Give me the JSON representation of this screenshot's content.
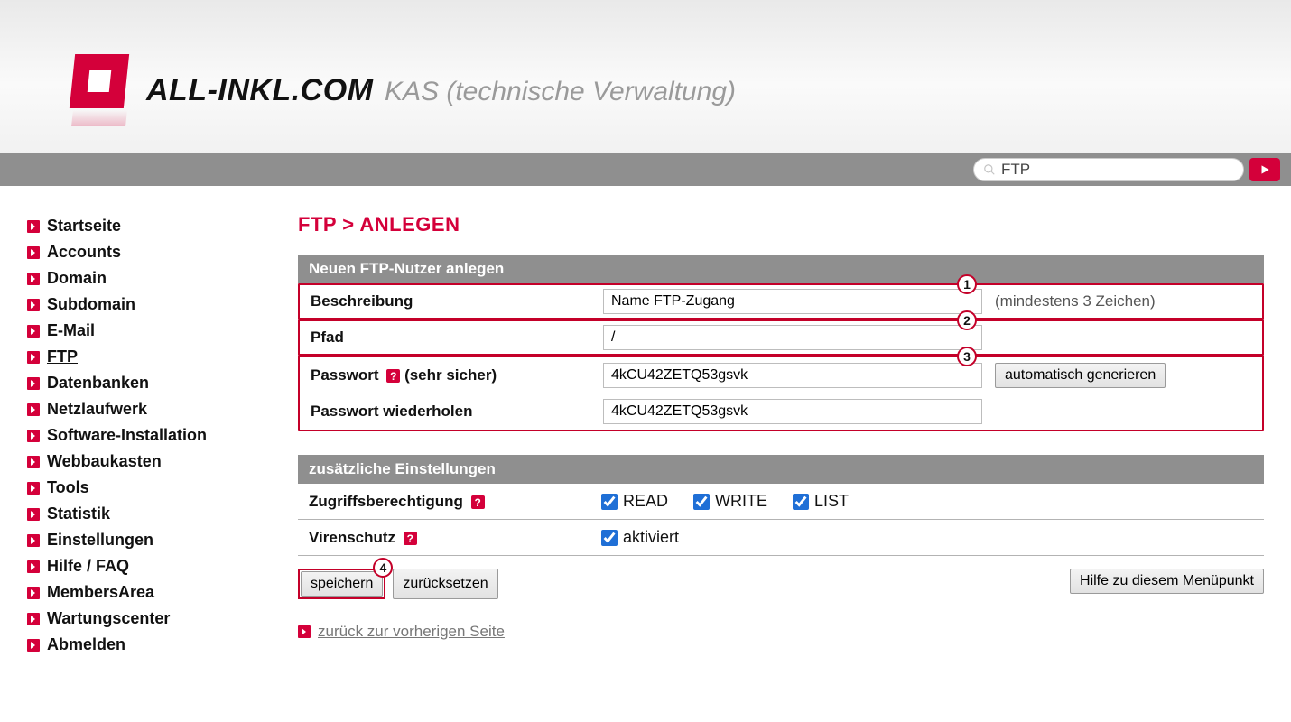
{
  "header": {
    "logo_text": "ALL-INKL.COM",
    "subtitle": "KAS (technische Verwaltung)"
  },
  "toolbar": {
    "search_value": "FTP"
  },
  "sidebar": {
    "items": [
      {
        "label": "Startseite",
        "active": false
      },
      {
        "label": "Accounts",
        "active": false
      },
      {
        "label": "Domain",
        "active": false
      },
      {
        "label": "Subdomain",
        "active": false
      },
      {
        "label": "E-Mail",
        "active": false
      },
      {
        "label": "FTP",
        "active": true
      },
      {
        "label": "Datenbanken",
        "active": false
      },
      {
        "label": "Netzlaufwerk",
        "active": false
      },
      {
        "label": "Software-Installation",
        "active": false
      },
      {
        "label": "Webbaukasten",
        "active": false
      },
      {
        "label": "Tools",
        "active": false
      },
      {
        "label": "Statistik",
        "active": false
      },
      {
        "label": "Einstellungen",
        "active": false
      },
      {
        "label": "Hilfe / FAQ",
        "active": false
      },
      {
        "label": "MembersArea",
        "active": false
      },
      {
        "label": "Wartungscenter",
        "active": false
      },
      {
        "label": "Abmelden",
        "active": false
      }
    ]
  },
  "main": {
    "title": "FTP > ANLEGEN",
    "panel1": {
      "heading": "Neuen FTP-Nutzer anlegen",
      "rows": {
        "beschreibung": {
          "label": "Beschreibung",
          "value": "Name FTP-Zugang",
          "hint": "(mindestens 3 Zeichen)",
          "step": "1"
        },
        "pfad": {
          "label": "Pfad",
          "value": "/",
          "step": "2"
        },
        "passwort": {
          "label": "Passwort",
          "strength": "(sehr sicher)",
          "value": "4kCU42ZETQ53gsvk",
          "gen_btn": "automatisch generieren",
          "step": "3"
        },
        "passwort2": {
          "label": "Passwort wiederholen",
          "value": "4kCU42ZETQ53gsvk"
        }
      }
    },
    "panel2": {
      "heading": "zusätzliche Einstellungen",
      "rows": {
        "zugriff": {
          "label": "Zugriffsberechtigung",
          "opts": {
            "read": "READ",
            "write": "WRITE",
            "list": "LIST"
          }
        },
        "virus": {
          "label": "Virenschutz",
          "opt": "aktiviert"
        }
      }
    },
    "buttons": {
      "save": "speichern",
      "reset": "zurücksetzen",
      "help": "Hilfe zu diesem Menüpunkt",
      "step": "4"
    },
    "backlink": "zurück zur vorherigen Seite"
  }
}
